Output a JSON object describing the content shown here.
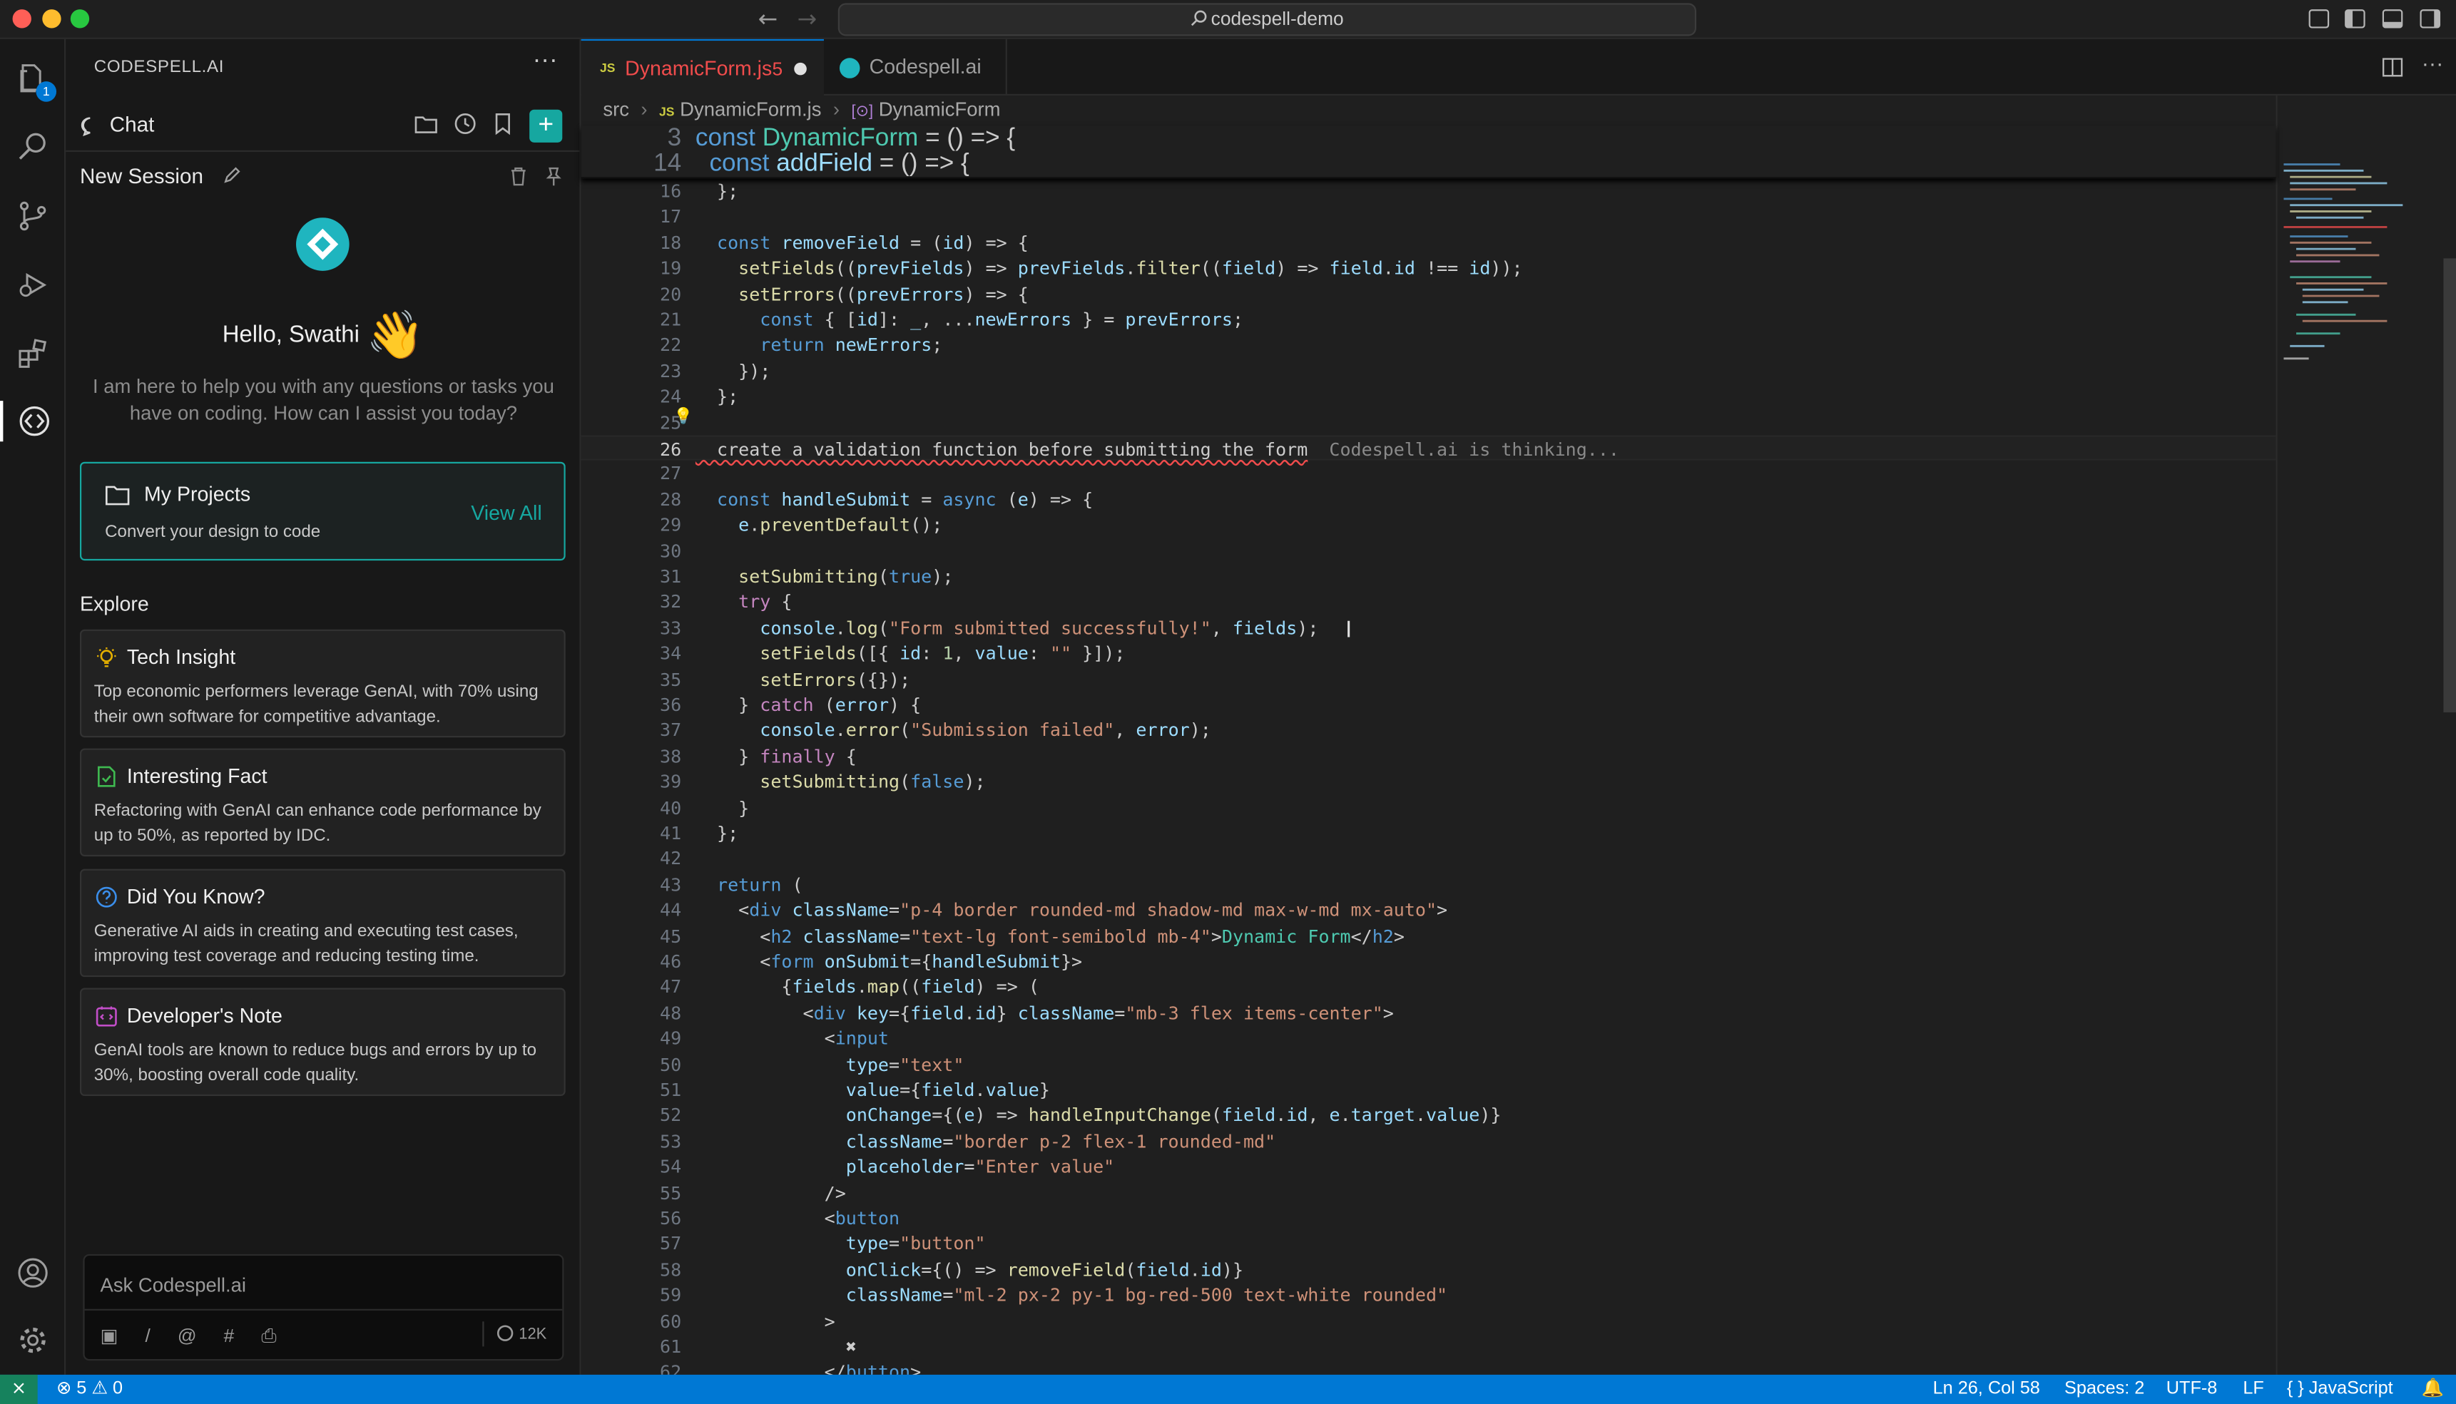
{
  "window": {
    "title": "codespell-demo"
  },
  "activity_bar": {
    "explorer_badge": "1"
  },
  "sidebar": {
    "title": "CODESPELL.AI",
    "chat_label": "Chat",
    "session_title": "New Session",
    "greeting": "Hello, Swathi",
    "wave": "👋",
    "intro": "I am here to help you with any questions or tasks you have on coding. How can I assist you today?",
    "projects": {
      "title": "My Projects",
      "subtitle": "Convert your design to code",
      "view_all": "View All"
    },
    "explore_label": "Explore",
    "cards": [
      {
        "title": "Tech Insight",
        "body": "Top economic performers leverage GenAI, with 70% using their own software for competitive advantage.",
        "icon": "lightbulb-icon",
        "color": "#e5b000"
      },
      {
        "title": "Interesting Fact",
        "body": "Refactoring with GenAI can enhance code performance by up to 50%, as reported by IDC.",
        "icon": "document-check-icon",
        "color": "#3fb950"
      },
      {
        "title": "Did You Know?",
        "body": "Generative AI aids in creating and executing test cases, improving test coverage and reducing testing time.",
        "icon": "question-icon",
        "color": "#3b8eea"
      },
      {
        "title": "Developer's Note",
        "body": "GenAI tools are known to reduce bugs and errors by up to 30%, boosting overall code quality.",
        "icon": "code-note-icon",
        "color": "#c24ec8"
      }
    ],
    "ask": {
      "placeholder": "Ask Codespell.ai",
      "tools": "▣ / @ # ⎙",
      "tokens": "12K"
    }
  },
  "editor": {
    "tabs": [
      {
        "label": "DynamicForm.js",
        "problems": "5",
        "file_badge": "JS"
      },
      {
        "label": "Codespell.ai"
      }
    ],
    "breadcrumb": {
      "folder": "src",
      "file_badge": "JS",
      "file": "DynamicForm.js",
      "symbol": "DynamicForm"
    },
    "sticky_lines": [
      {
        "n": "3",
        "code": "const DynamicForm = () => {"
      },
      {
        "n": "14",
        "code": "  const addField = () => {"
      }
    ],
    "lines": [
      {
        "n": "16",
        "code": "  };"
      },
      {
        "n": "17",
        "code": ""
      },
      {
        "n": "18",
        "code": "  const removeField = (id) => {"
      },
      {
        "n": "19",
        "code": "    setFields((prevFields) => prevFields.filter((field) => field.id !== id));"
      },
      {
        "n": "20",
        "code": "    setErrors((prevErrors) => {"
      },
      {
        "n": "21",
        "code": "      const { [id]: _, ...newErrors } = prevErrors;"
      },
      {
        "n": "22",
        "code": "      return newErrors;"
      },
      {
        "n": "23",
        "code": "    });"
      },
      {
        "n": "24",
        "code": "  };"
      },
      {
        "n": "25",
        "code": ""
      },
      {
        "n": "26",
        "code": "  create a validation function before submitting the form",
        "ghost": "  Codespell.ai is thinking..."
      },
      {
        "n": "27",
        "code": ""
      },
      {
        "n": "28",
        "code": "  const handleSubmit = async (e) => {"
      },
      {
        "n": "29",
        "code": "    e.preventDefault();"
      },
      {
        "n": "30",
        "code": ""
      },
      {
        "n": "31",
        "code": "    setSubmitting(true);"
      },
      {
        "n": "32",
        "code": "    try {"
      },
      {
        "n": "33",
        "code": "      console.log(\"Form submitted successfully!\", fields);"
      },
      {
        "n": "34",
        "code": "      setFields([{ id: 1, value: \"\" }]);"
      },
      {
        "n": "35",
        "code": "      setErrors({});"
      },
      {
        "n": "36",
        "code": "    } catch (error) {"
      },
      {
        "n": "37",
        "code": "      console.error(\"Submission failed\", error);"
      },
      {
        "n": "38",
        "code": "    } finally {"
      },
      {
        "n": "39",
        "code": "      setSubmitting(false);"
      },
      {
        "n": "40",
        "code": "    }"
      },
      {
        "n": "41",
        "code": "  };"
      },
      {
        "n": "42",
        "code": ""
      },
      {
        "n": "43",
        "code": "  return ("
      },
      {
        "n": "44",
        "code": "    <div className=\"p-4 border rounded-md shadow-md max-w-md mx-auto\">"
      },
      {
        "n": "45",
        "code": "      <h2 className=\"text-lg font-semibold mb-4\">Dynamic Form</h2>"
      },
      {
        "n": "46",
        "code": "      <form onSubmit={handleSubmit}>"
      },
      {
        "n": "47",
        "code": "        {fields.map((field) => ("
      },
      {
        "n": "48",
        "code": "          <div key={field.id} className=\"mb-3 flex items-center\">"
      },
      {
        "n": "49",
        "code": "            <input"
      },
      {
        "n": "50",
        "code": "              type=\"text\""
      },
      {
        "n": "51",
        "code": "              value={field.value}"
      },
      {
        "n": "52",
        "code": "              onChange={(e) => handleInputChange(field.id, e.target.value)}"
      },
      {
        "n": "53",
        "code": "              className=\"border p-2 flex-1 rounded-md\""
      },
      {
        "n": "54",
        "code": "              placeholder=\"Enter value\""
      },
      {
        "n": "55",
        "code": "            />"
      },
      {
        "n": "56",
        "code": "            <button"
      },
      {
        "n": "57",
        "code": "              type=\"button\""
      },
      {
        "n": "58",
        "code": "              onClick={() => removeField(field.id)}"
      },
      {
        "n": "59",
        "code": "              className=\"ml-2 px-2 py-1 bg-red-500 text-white rounded\""
      },
      {
        "n": "60",
        "code": "            >"
      },
      {
        "n": "61",
        "code": "              ✖"
      },
      {
        "n": "62",
        "code": "            </button>"
      }
    ],
    "current_line": "26"
  },
  "status_bar": {
    "errors": "5",
    "warnings": "0",
    "position": "Ln 26, Col 58",
    "spaces": "Spaces: 2",
    "encoding": "UTF-8",
    "eol": "LF",
    "language": "JavaScript"
  },
  "colors": {
    "accent": "#0078d4",
    "brand": "#16a7a0",
    "error": "#f14c4c"
  }
}
